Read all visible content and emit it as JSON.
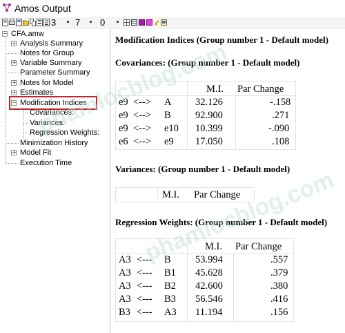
{
  "window": {
    "title": "Amos Output"
  },
  "toolbar": {
    "num_a": "3",
    "num_b": "7",
    "num_c": "0"
  },
  "tree": {
    "root": "CFA.amw",
    "items": [
      {
        "label": "Analysis Summary"
      },
      {
        "label": "Notes for Group"
      },
      {
        "label": "Variable Summary"
      },
      {
        "label": "Parameter Summary"
      },
      {
        "label": "Notes for Model"
      },
      {
        "label": "Estimates"
      },
      {
        "label": "Modification Indices"
      },
      {
        "label": "Covariances:"
      },
      {
        "label": "Variances:"
      },
      {
        "label": "Regression Weights:"
      },
      {
        "label": "Minimization History"
      },
      {
        "label": "Model Fit"
      },
      {
        "label": "Execution Time"
      }
    ]
  },
  "report": {
    "heading": "Modification Indices (Group number 1 - Default model)",
    "covariances": {
      "title": "Covariances: (Group number 1 - Default model)",
      "col_mi": "M.I.",
      "col_pc": "Par Change",
      "rows": [
        {
          "a": "e9",
          "arrow": "<-->",
          "b": "A",
          "mi": "32.126",
          "pc": "-.158"
        },
        {
          "a": "e9",
          "arrow": "<-->",
          "b": "B",
          "mi": "92.900",
          "pc": ".271"
        },
        {
          "a": "e9",
          "arrow": "<-->",
          "b": "e10",
          "mi": "10.399",
          "pc": "-.090"
        },
        {
          "a": "e6",
          "arrow": "<-->",
          "b": "e9",
          "mi": "17.050",
          "pc": ".108"
        }
      ]
    },
    "variances": {
      "title": "Variances: (Group number 1 - Default model)",
      "col_mi": "M.I.",
      "col_pc": "Par Change"
    },
    "regression": {
      "title": "Regression Weights: (Group number 1 - Default model)",
      "col_mi": "M.I.",
      "col_pc": "Par Change",
      "rows": [
        {
          "a": "A3",
          "arrow": "<---",
          "b": "B",
          "mi": "53.994",
          "pc": ".557"
        },
        {
          "a": "A3",
          "arrow": "<---",
          "b": "B1",
          "mi": "45.628",
          "pc": ".379"
        },
        {
          "a": "A3",
          "arrow": "<---",
          "b": "B2",
          "mi": "42.600",
          "pc": ".380"
        },
        {
          "a": "A3",
          "arrow": "<---",
          "b": "B3",
          "mi": "56.546",
          "pc": ".416"
        },
        {
          "a": "B3",
          "arrow": "<---",
          "b": "A3",
          "mi": "11.194",
          "pc": ".156"
        }
      ]
    }
  },
  "watermark": {
    "text": "phamlocblog.com"
  },
  "colors": {
    "highlight_border": "#c4262e",
    "watermark": "#b9e1cd"
  }
}
